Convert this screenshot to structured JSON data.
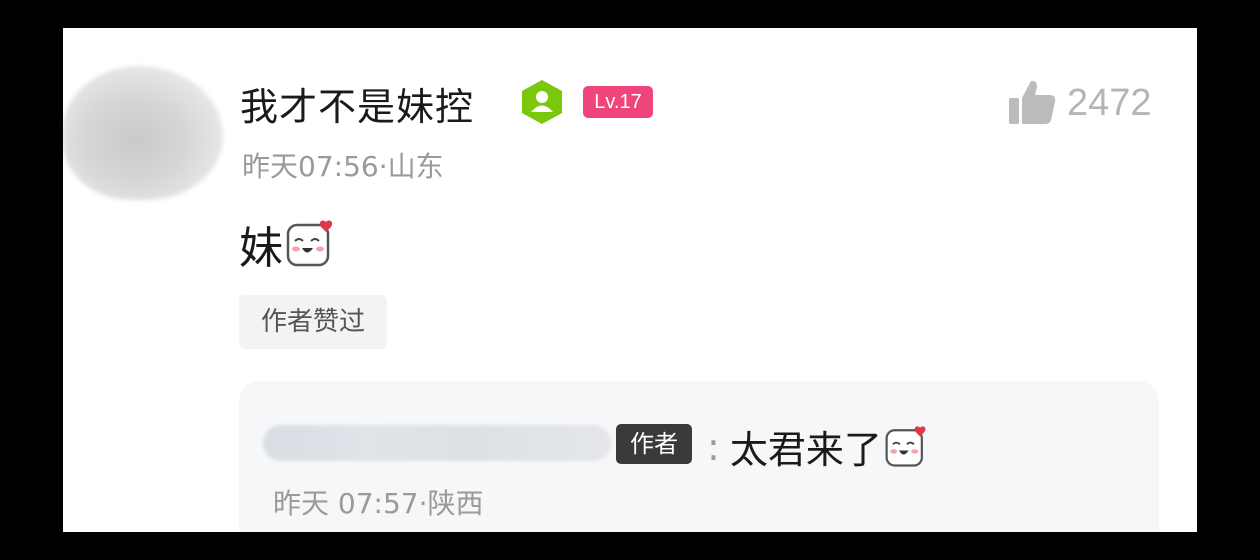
{
  "post": {
    "username": "我才不是妹控",
    "level": "Lv.17",
    "time": "昨天07:56",
    "location": "山东",
    "like_count": "2472",
    "comment_text": "妹",
    "author_liked_label": "作者赞过"
  },
  "reply": {
    "author_tag": "作者",
    "colon": ":",
    "text": "太君来了",
    "time": "昨天 07:57",
    "location": "陕西"
  },
  "icons": {
    "user_badge": "user-verified-icon",
    "like": "thumbs-up-icon",
    "emoji": "blush-face-emoji"
  },
  "colors": {
    "level_badge": "#f0457a",
    "user_badge": "#7ac70c",
    "author_tag": "#3a3a3a",
    "meta_text": "#9a9a9a"
  }
}
